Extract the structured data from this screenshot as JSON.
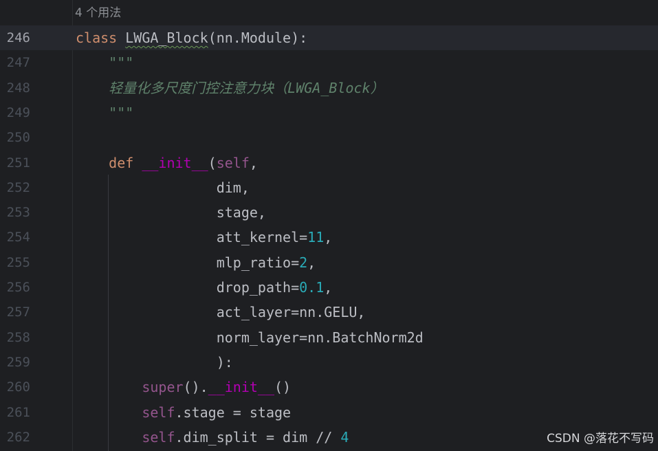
{
  "editor": {
    "usage_hint": "4 个用法",
    "current_line": 246,
    "lines": [
      {
        "number": "246",
        "segments": [
          {
            "type": "kw",
            "text": "class"
          },
          {
            "type": "plain",
            "text": " "
          },
          {
            "type": "cls",
            "text": "LWGA_Block"
          },
          {
            "type": "plain",
            "text": "(nn.Module):"
          }
        ]
      },
      {
        "number": "247",
        "segments": [
          {
            "type": "plain",
            "text": "    "
          },
          {
            "type": "doc",
            "text": "\"\"\""
          }
        ]
      },
      {
        "number": "248",
        "segments": [
          {
            "type": "plain",
            "text": "    "
          },
          {
            "type": "doc",
            "text": "轻量化多尺度门控注意力块（LWGA_Block）"
          }
        ]
      },
      {
        "number": "249",
        "segments": [
          {
            "type": "plain",
            "text": "    "
          },
          {
            "type": "doc",
            "text": "\"\"\""
          }
        ]
      },
      {
        "number": "250",
        "segments": []
      },
      {
        "number": "251",
        "segments": [
          {
            "type": "plain",
            "text": "    "
          },
          {
            "type": "kw",
            "text": "def"
          },
          {
            "type": "plain",
            "text": " "
          },
          {
            "type": "dunder",
            "text": "__init__"
          },
          {
            "type": "plain",
            "text": "("
          },
          {
            "type": "selfp",
            "text": "self"
          },
          {
            "type": "plain",
            "text": ","
          }
        ]
      },
      {
        "number": "252",
        "segments": [
          {
            "type": "plain",
            "text": "                 dim,"
          }
        ]
      },
      {
        "number": "253",
        "segments": [
          {
            "type": "plain",
            "text": "                 stage,"
          }
        ]
      },
      {
        "number": "254",
        "segments": [
          {
            "type": "plain",
            "text": "                 att_kernel="
          },
          {
            "type": "num",
            "text": "11"
          },
          {
            "type": "plain",
            "text": ","
          }
        ]
      },
      {
        "number": "255",
        "segments": [
          {
            "type": "plain",
            "text": "                 mlp_ratio="
          },
          {
            "type": "num",
            "text": "2"
          },
          {
            "type": "plain",
            "text": ","
          }
        ]
      },
      {
        "number": "256",
        "segments": [
          {
            "type": "plain",
            "text": "                 drop_path="
          },
          {
            "type": "num",
            "text": "0.1"
          },
          {
            "type": "plain",
            "text": ","
          }
        ]
      },
      {
        "number": "257",
        "segments": [
          {
            "type": "plain",
            "text": "                 act_layer=nn.GELU,"
          }
        ]
      },
      {
        "number": "258",
        "segments": [
          {
            "type": "plain",
            "text": "                 norm_layer=nn.BatchNorm2d"
          }
        ]
      },
      {
        "number": "259",
        "segments": [
          {
            "type": "plain",
            "text": "                 ):"
          }
        ]
      },
      {
        "number": "260",
        "segments": [
          {
            "type": "plain",
            "text": "        "
          },
          {
            "type": "selfp",
            "text": "super"
          },
          {
            "type": "plain",
            "text": "()."
          },
          {
            "type": "dunder",
            "text": "__init__"
          },
          {
            "type": "plain",
            "text": "()"
          }
        ]
      },
      {
        "number": "261",
        "segments": [
          {
            "type": "plain",
            "text": "        "
          },
          {
            "type": "selfp",
            "text": "self"
          },
          {
            "type": "plain",
            "text": ".stage = stage"
          }
        ]
      },
      {
        "number": "262",
        "segments": [
          {
            "type": "plain",
            "text": "        "
          },
          {
            "type": "selfp",
            "text": "self"
          },
          {
            "type": "plain",
            "text": ".dim_split = dim // "
          },
          {
            "type": "num",
            "text": "4"
          }
        ]
      }
    ]
  },
  "watermark": "CSDN @落花不写码",
  "colors": {
    "background": "#1e1f22",
    "keyword": "#cf8e6d",
    "docstring": "#5f826b",
    "dunder": "#b200b2",
    "self": "#94558d",
    "number": "#2aacb8",
    "text": "#bcbec4",
    "line_number": "#4b5059"
  }
}
